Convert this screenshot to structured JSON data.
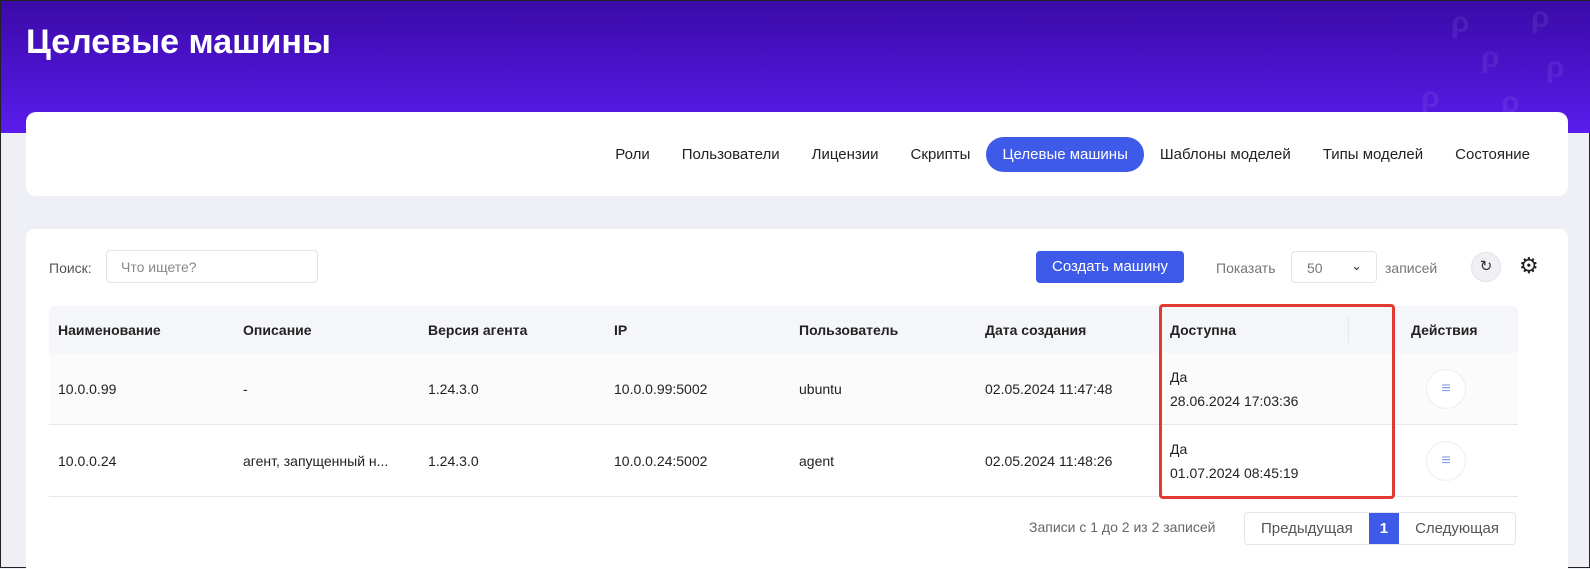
{
  "page_title": "Целевые машины",
  "nav": {
    "tabs": [
      {
        "label": "Роли"
      },
      {
        "label": "Пользователи"
      },
      {
        "label": "Лицензии"
      },
      {
        "label": "Скрипты"
      },
      {
        "label": "Целевые машины",
        "active": true
      },
      {
        "label": "Шаблоны моделей"
      },
      {
        "label": "Типы моделей"
      },
      {
        "label": "Состояние"
      }
    ]
  },
  "toolbar": {
    "search_label": "Поиск:",
    "search_placeholder": "Что ищете?",
    "create_label": "Создать машину",
    "show_label": "Показать",
    "page_size": "50",
    "records_label": "записей"
  },
  "table": {
    "headers": [
      "Наименование",
      "Описание",
      "Версия агента",
      "IP",
      "Пользователь",
      "Дата создания",
      "Доступна",
      "Действия"
    ],
    "rows": [
      {
        "name": "10.0.0.99",
        "description": "-",
        "agent_version": "1.24.3.0",
        "ip": "10.0.0.99:5002",
        "user": "ubuntu",
        "created": "02.05.2024 11:47:48",
        "available": "Да",
        "available_time": "28.06.2024 17:03:36"
      },
      {
        "name": "10.0.0.24",
        "description": "агент, запущенный н...",
        "agent_version": "1.24.3.0",
        "ip": "10.0.0.24:5002",
        "user": "agent",
        "created": "02.05.2024 11:48:26",
        "available": "Да",
        "available_time": "01.07.2024 08:45:19"
      }
    ]
  },
  "pagination": {
    "info": "Записи с 1 до 2 из 2 записей",
    "prev": "Предыдущая",
    "current": "1",
    "next": "Следующая"
  }
}
